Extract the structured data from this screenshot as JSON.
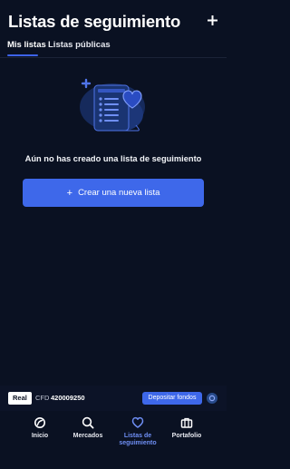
{
  "header": {
    "title": "Listas de seguimiento",
    "add_icon": "plus-icon"
  },
  "tabs": [
    {
      "label": "Mis listas",
      "active": true
    },
    {
      "label": "Listas públicas",
      "active": false
    }
  ],
  "empty_state": {
    "illustration": "watchlist-heart-illustration",
    "message": "Aún no has creado una lista de seguimiento",
    "button_label": "Crear una nueva lista",
    "button_icon": "+"
  },
  "account": {
    "mode": "Real",
    "type": "CFD",
    "number": "420009250",
    "deposit_label": "Depositar fondos",
    "toggle_icon": "account-switch-icon"
  },
  "nav": [
    {
      "label": "Inicio",
      "icon": "home-icon",
      "active": false
    },
    {
      "label": "Mercados",
      "icon": "search-icon",
      "active": false
    },
    {
      "label": "Listas de seguimiento",
      "icon": "heart-icon",
      "active": true
    },
    {
      "label": "Portafolio",
      "icon": "briefcase-icon",
      "active": false
    }
  ],
  "colors": {
    "background": "#0a1122",
    "accent": "#3e68ea",
    "active_nav": "#6f8ff5"
  }
}
